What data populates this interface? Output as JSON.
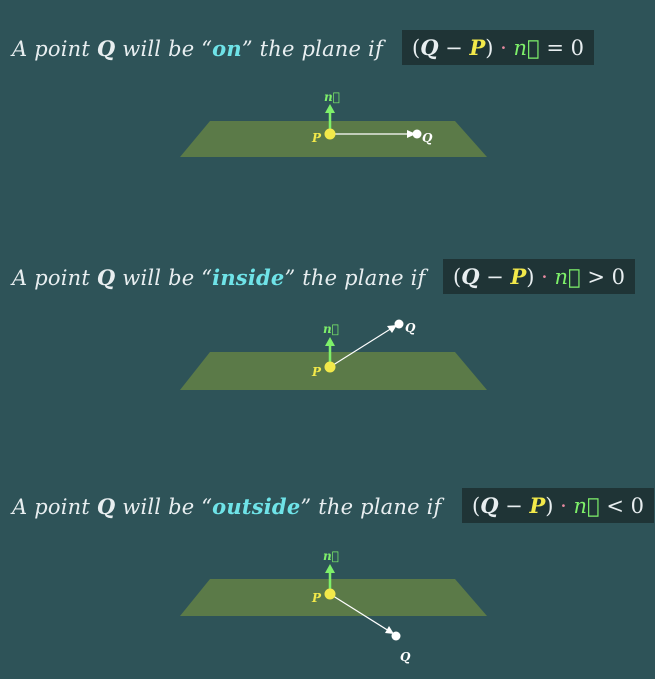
{
  "sections": [
    {
      "prefix": "A point ",
      "q": "Q",
      "mid": " will be “",
      "keyword": "on",
      "suffix": "” the plane if",
      "formula": {
        "q": "Q",
        "minus": " − ",
        "p": "P",
        "dot": "·",
        "n": "n⃗",
        "rel": "=",
        "zero": "0"
      }
    },
    {
      "prefix": "A point ",
      "q": "Q",
      "mid": " will be “",
      "keyword": "inside",
      "suffix": "” the plane if",
      "formula": {
        "q": "Q",
        "minus": " − ",
        "p": "P",
        "dot": "·",
        "n": "n⃗",
        "rel": ">",
        "zero": "0"
      }
    },
    {
      "prefix": "A point ",
      "q": "Q",
      "mid": " will be “",
      "keyword": "outside",
      "suffix": "” the plane if",
      "formula": {
        "q": "Q",
        "minus": " − ",
        "p": "P",
        "dot": "·",
        "n": "n⃗",
        "rel": "<",
        "zero": "0"
      }
    }
  ],
  "labels": {
    "p": "P",
    "q": "Q",
    "n": "n⃗"
  },
  "colors": {
    "background": "#2e5358",
    "plane": "#5b7a48",
    "point_p": "#f2e94a",
    "normal": "#7ef06a",
    "keyword": "#6fe3e8",
    "formula_bg": "#1f3436"
  }
}
